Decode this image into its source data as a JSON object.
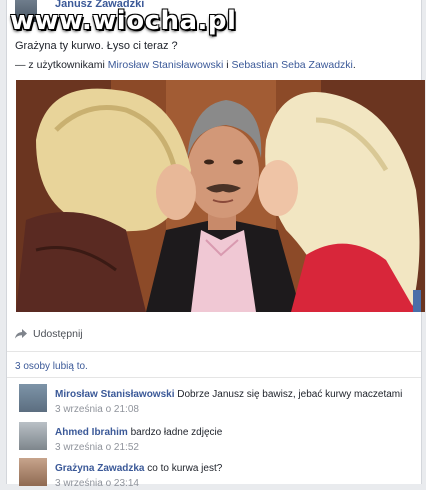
{
  "post": {
    "author": "Janusz Zawadzki",
    "watermark": "www.wiocha.pl",
    "text": "Grażyna ty kurwo. Łyso ci teraz ?",
    "tagged_prefix": "— z użytkownikami ",
    "tagged_user_1": "Mirosław Stanisławowski",
    "tagged_joiner": " i ",
    "tagged_user_2": "Sebastian Seba Zawadzki",
    "tagged_suffix": "."
  },
  "actions": {
    "share_label": "Udostępnij"
  },
  "likes": {
    "label": "3 osoby lubią to."
  },
  "comments": [
    {
      "author": "Mirosław Stanisławowski",
      "text": "Dobrze Janusz się bawisz, jebać kurwy maczetami",
      "time": "3 września o 21:08"
    },
    {
      "author": "Ahmed Ibrahim",
      "text": "bardzo ładne zdjęcie",
      "time": "3 września o 21:52"
    },
    {
      "author": "Grażyna Zawadzka",
      "text": "co to kurwa jest?",
      "time": "3 września o 23:14"
    }
  ],
  "icons": {
    "share": "share-arrow-icon"
  },
  "colors": {
    "link": "#3b5998",
    "text": "#1d2129",
    "muted": "#90949c"
  }
}
